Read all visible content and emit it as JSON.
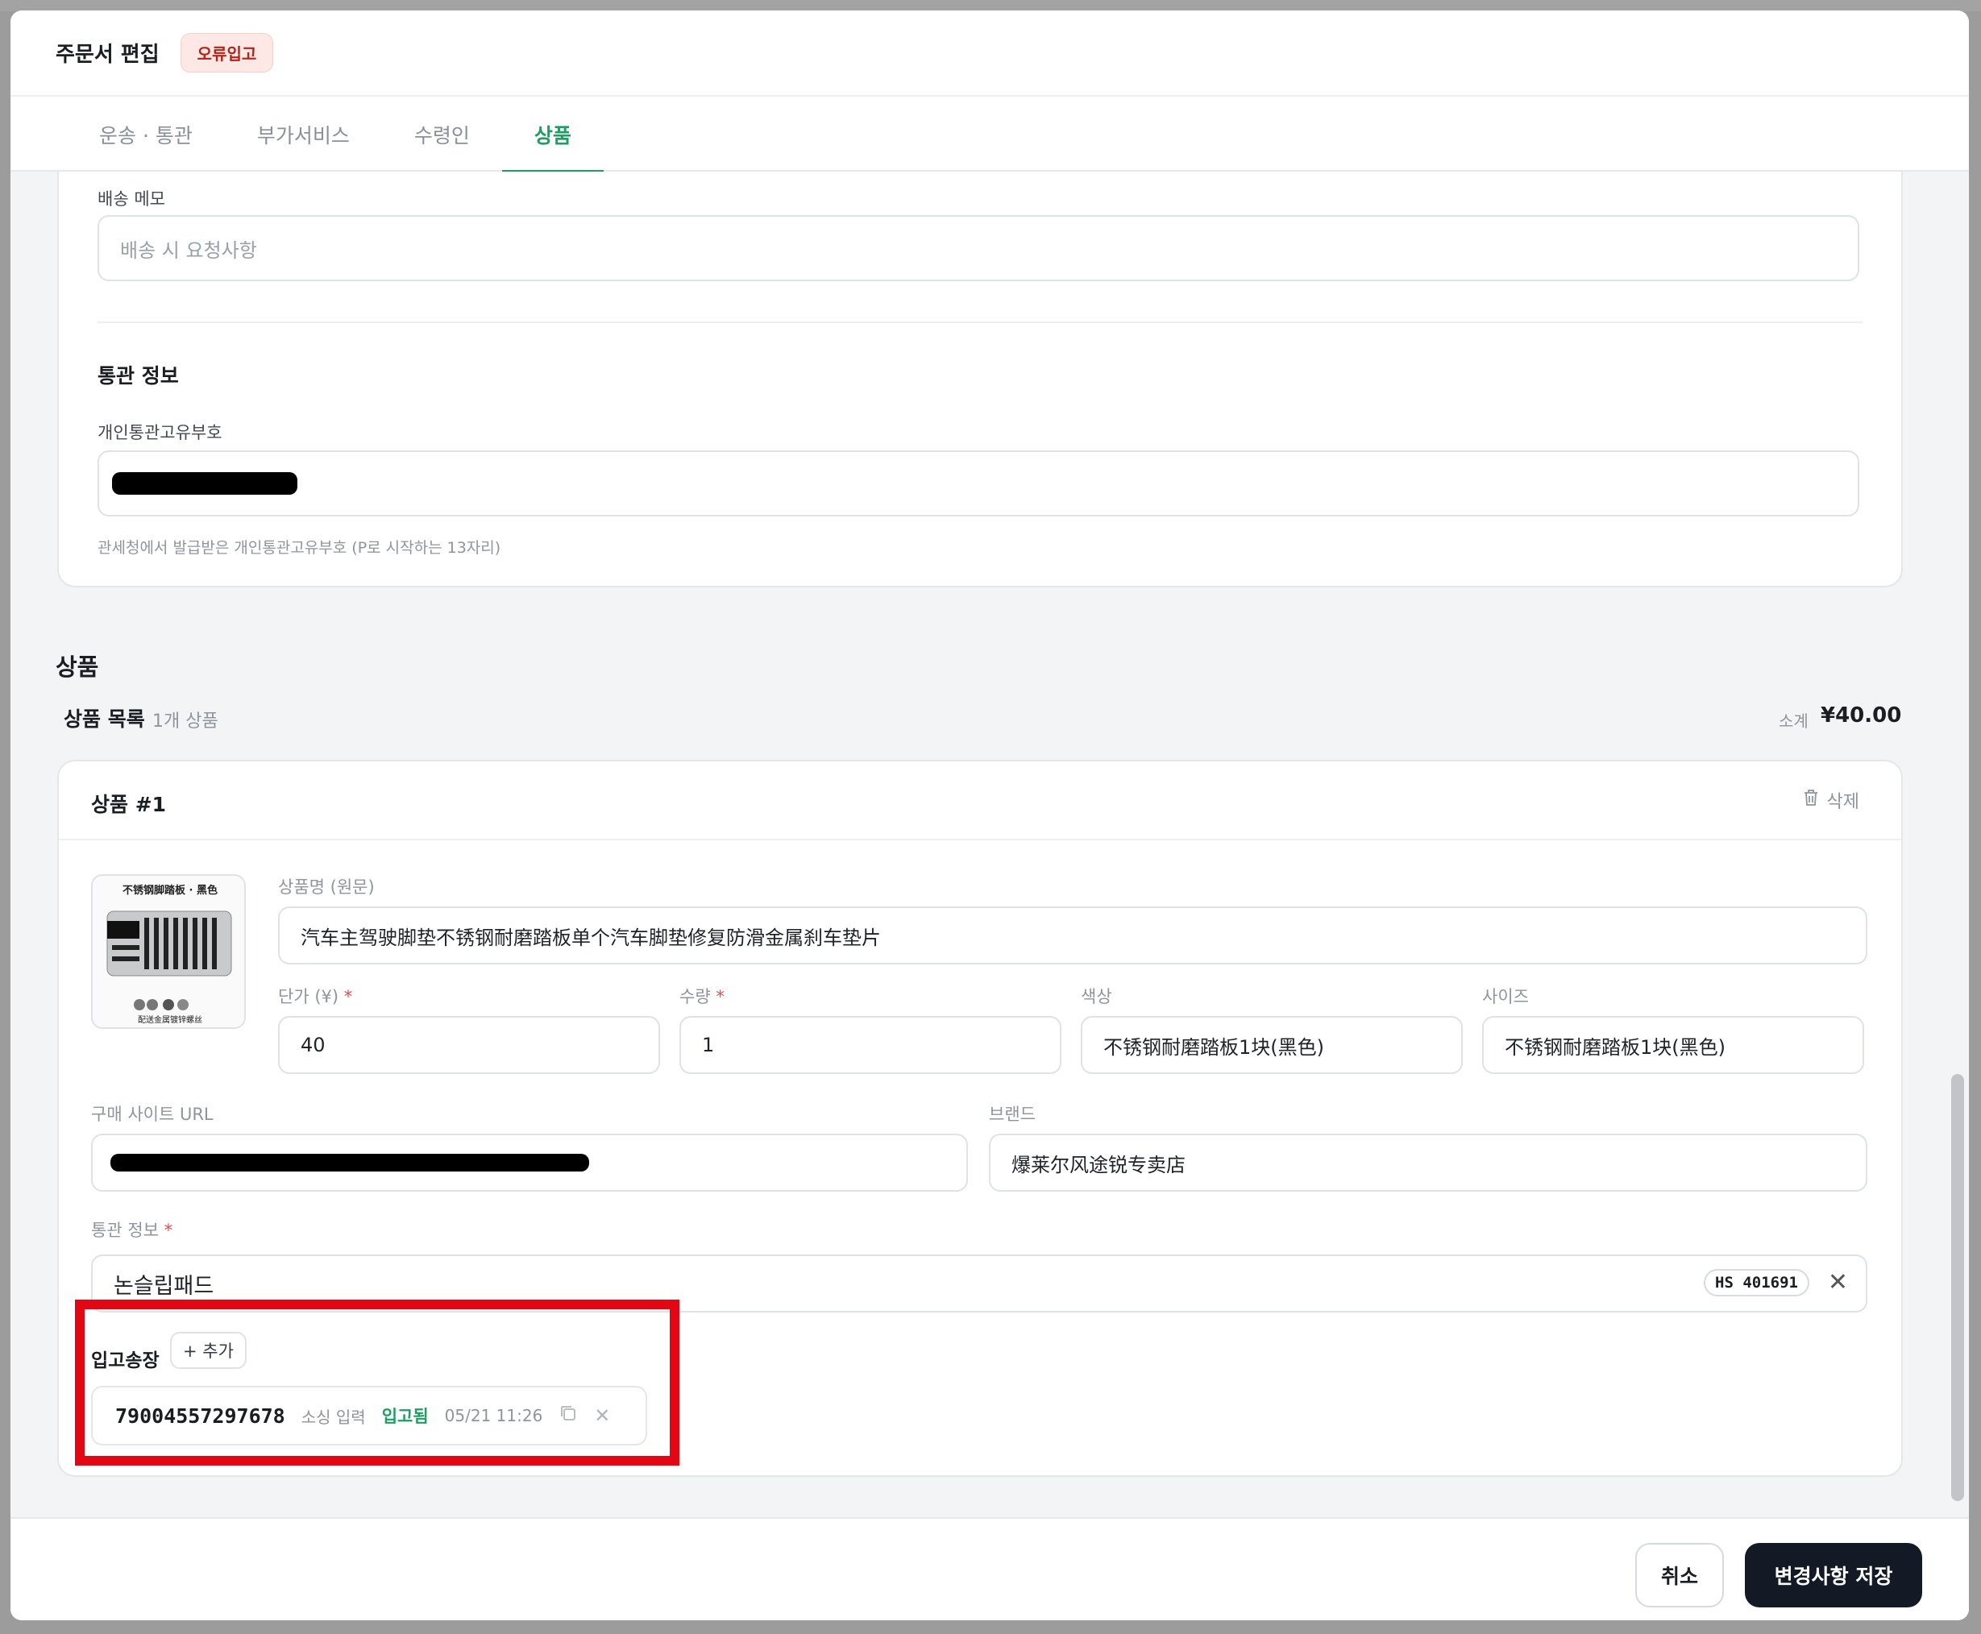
{
  "header": {
    "title": "주문서 편집",
    "badge": "오류입고"
  },
  "tabs": [
    {
      "label": "운송 · 통관"
    },
    {
      "label": "부가서비스"
    },
    {
      "label": "수령인"
    },
    {
      "label": "상품"
    }
  ],
  "shipping": {
    "memo_label": "배송 메모",
    "memo_placeholder": "배송 시 요청사항"
  },
  "customs": {
    "title": "통관 정보",
    "pccc_label": "개인통관고유부호",
    "pccc_hint": "관세청에서 발급받은 개인통관고유부호 (P로 시작하는 13자리)"
  },
  "products": {
    "section_title": "상품",
    "list_title": "상품 목록",
    "count": "1개 상품",
    "subtotal_label": "소계",
    "subtotal_value": "¥40.00",
    "item": {
      "title": "상품 #1",
      "delete_label": "삭제",
      "thumb_caption_top": "不锈钢脚踏板 · 黑色",
      "thumb_caption_bottom": "配送金属镀锌螺丝",
      "name_label": "상품명 (원문)",
      "name_value": "汽车主驾驶脚垫不锈钢耐磨踏板单个汽车脚垫修复防滑金属刹车垫片",
      "price_label": "단가 (¥)",
      "price_value": "40",
      "qty_label": "수량",
      "qty_value": "1",
      "color_label": "색상",
      "color_value": "不锈钢耐磨踏板1块(黑色)",
      "size_label": "사이즈",
      "size_value": "不锈钢耐磨踏板1块(黑色)",
      "url_label": "구매 사이트 URL",
      "brand_label": "브랜드",
      "brand_value": "爆莱尔风途锐专卖店",
      "customs_label": "통관 정보",
      "customs_value": "논슬립패드",
      "hs_code": "HS 401691",
      "inbound_label": "입고송장",
      "add_label": "+ 추가",
      "tracking": {
        "number": "79004557297678",
        "source": "소싱 입력",
        "status": "입고됨",
        "time": "05/21 11:26"
      }
    }
  },
  "footer": {
    "cancel": "취소",
    "save": "변경사항 저장"
  },
  "colors": {
    "accent": "#1f9d63",
    "primary_button": "#131a26",
    "highlight": "#e30613",
    "badge_bg": "#fde8e6"
  },
  "icons": {
    "delete": "trash-icon",
    "copy": "copy-icon",
    "remove": "close-icon",
    "clear": "close-icon"
  }
}
